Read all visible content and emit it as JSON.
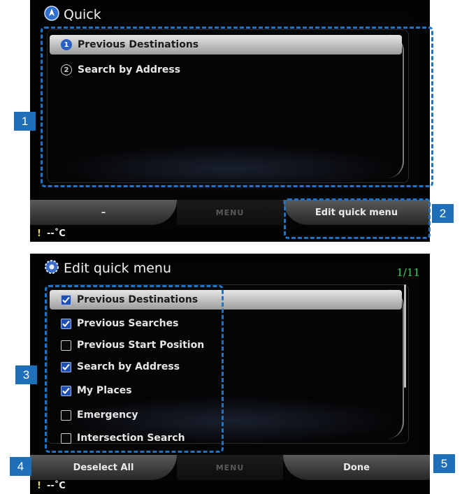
{
  "screen1": {
    "title": "Quick",
    "items": [
      {
        "num": "1",
        "label": "Previous Destinations",
        "selected": true
      },
      {
        "num": "2",
        "label": "Search by Address",
        "selected": false
      }
    ],
    "bottom": {
      "left": "–",
      "menu": "MENU",
      "right": "Edit quick menu"
    },
    "status": {
      "icon": "!",
      "temp": "--˚C"
    }
  },
  "screen2": {
    "title": "Edit quick menu",
    "page": "1/11",
    "items": [
      {
        "label": "Previous Destinations",
        "checked": true,
        "selected": true
      },
      {
        "label": "Previous Searches",
        "checked": true,
        "selected": false
      },
      {
        "label": "Previous Start Position",
        "checked": false,
        "selected": false
      },
      {
        "label": "Search by Address",
        "checked": true,
        "selected": false
      },
      {
        "label": "My Places",
        "checked": true,
        "selected": false
      },
      {
        "label": "Emergency",
        "checked": false,
        "selected": false
      },
      {
        "label": "Intersection Search",
        "checked": false,
        "selected": false
      }
    ],
    "bottom": {
      "left": "Deselect All",
      "menu": "MENU",
      "right": "Done"
    },
    "status": {
      "icon": "!",
      "temp": "--˚C"
    }
  },
  "callouts": [
    "1",
    "2",
    "3",
    "4",
    "5"
  ],
  "colors": {
    "callout": "#1e6fb8",
    "highlight_dash": "#1f73c9",
    "page_counter": "#3ccf58"
  }
}
